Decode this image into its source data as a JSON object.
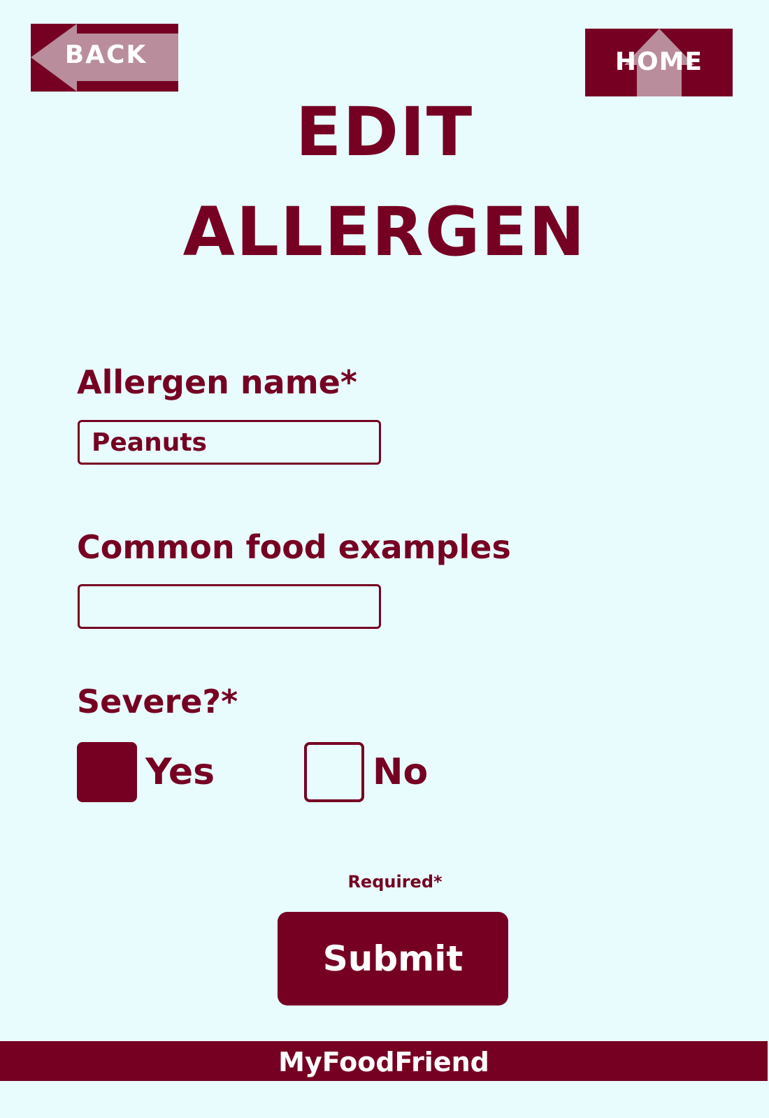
{
  "colors": {
    "background": "#e8fbfd",
    "accent": "#760022",
    "arrow": "#b98d9c",
    "button_text": "#ffffff"
  },
  "header": {
    "back_label": "BACK",
    "back_icon": "left-arrow-icon",
    "home_label": "HOME",
    "home_icon": "up-arrow-icon"
  },
  "page": {
    "title_line1": "EDIT",
    "title_line2": "ALLERGEN"
  },
  "form": {
    "allergen_name": {
      "label": "Allergen name*",
      "value": "Peanuts"
    },
    "food_examples": {
      "label": "Common food examples",
      "value": ""
    },
    "severe": {
      "label": "Severe?*",
      "yes_label": "Yes",
      "no_label": "No",
      "selected": "Yes"
    },
    "required_note": "Required*",
    "submit_label": "Submit"
  },
  "footer": {
    "brand": "MyFoodFriend"
  }
}
